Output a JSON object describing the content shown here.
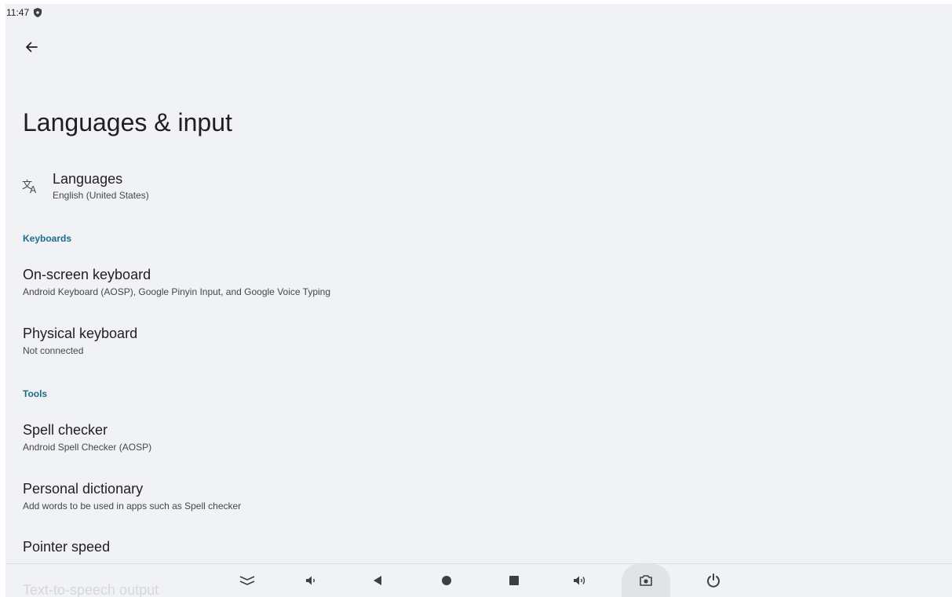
{
  "status_bar": {
    "time": "11:47",
    "icons": [
      "shield-icon"
    ]
  },
  "header": {
    "back_icon": "arrow-back-icon",
    "title": "Languages & input"
  },
  "languages": {
    "icon": "translate-icon",
    "title": "Languages",
    "summary": "English (United States)"
  },
  "keyboards": {
    "category": "Keyboards",
    "items": [
      {
        "title": "On-screen keyboard",
        "summary": "Android Keyboard (AOSP), Google Pinyin Input, and Google Voice Typing"
      },
      {
        "title": "Physical keyboard",
        "summary": "Not connected"
      }
    ]
  },
  "tools": {
    "category": "Tools",
    "items": [
      {
        "title": "Spell checker",
        "summary": "Android Spell Checker (AOSP)"
      },
      {
        "title": "Personal dictionary",
        "summary": "Add words to be used in apps such as Spell checker"
      },
      {
        "title": "Pointer speed",
        "summary": ""
      },
      {
        "title": "Text-to-speech output",
        "summary": ""
      }
    ]
  },
  "nav_bar": {
    "buttons": [
      "collapse-icon",
      "volume-down-icon",
      "back-triangle-icon",
      "home-circle-icon",
      "recents-square-icon",
      "volume-up-icon",
      "screenshot-camera-icon",
      "power-icon"
    ],
    "active": "screenshot-camera-icon"
  },
  "colors": {
    "background": "#f1f2f5",
    "accent": "#1b6c8a",
    "text_primary": "#1f1f1f",
    "text_secondary": "#444746"
  }
}
